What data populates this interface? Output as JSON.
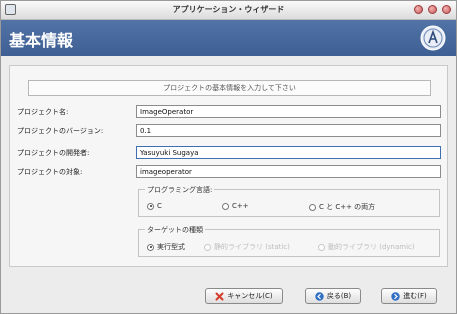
{
  "window": {
    "title": "アプリケーション・ウィザード"
  },
  "header": {
    "title": "基本情報"
  },
  "main": {
    "banner": "プロジェクトの基本情報を入力して下さい",
    "fields": [
      {
        "label": "プロジェクト名:",
        "value": "ImageOperator"
      },
      {
        "label": "プロジェクトのバージョン:",
        "value": "0.1"
      },
      {
        "label": "プロジェクトの開発者:",
        "value": "Yasuyuki Sugaya"
      },
      {
        "label": "プロジェクトの対象:",
        "value": "imageoperator"
      }
    ],
    "language_group": {
      "title": "プログラミング言語:",
      "options": [
        {
          "label": "C",
          "selected": true
        },
        {
          "label": "C++",
          "selected": false
        },
        {
          "label": "C と C++ の両方",
          "selected": false
        }
      ]
    },
    "target_group": {
      "title": "ターゲットの種類",
      "options": [
        {
          "label": "実行型式",
          "selected": true,
          "enabled": true
        },
        {
          "label": "静的ライブラリ (static)",
          "selected": false,
          "enabled": false
        },
        {
          "label": "動的ライブラリ (dynamic)",
          "selected": false,
          "enabled": false
        }
      ]
    }
  },
  "buttons": {
    "cancel": "キャンセル(C)",
    "back": "戻る(B)",
    "next": "進む(F)"
  },
  "colors": {
    "header": "#4a6a9e",
    "cancel_icon": "#d63b2b",
    "nav_icon": "#2f6fc4"
  },
  "icons": {
    "cancel": "x-icon",
    "back": "left-arrow-icon",
    "next": "right-arrow-icon"
  }
}
